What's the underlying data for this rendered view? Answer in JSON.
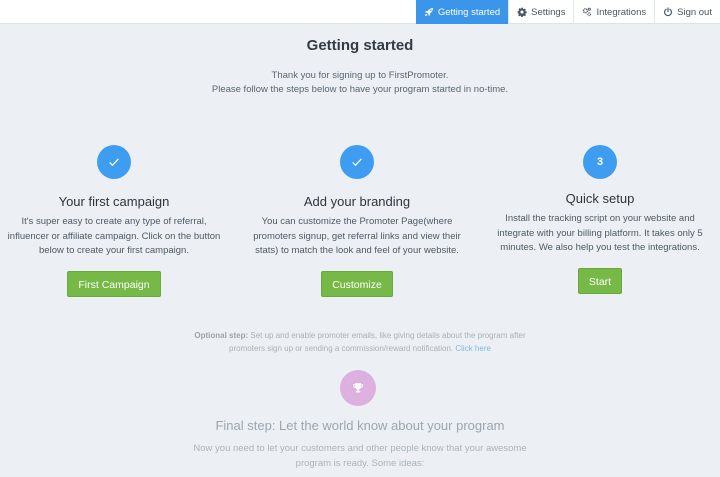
{
  "nav": {
    "items": [
      {
        "label": "Getting started",
        "icon": "rocket-icon"
      },
      {
        "label": "Settings",
        "icon": "gear-icon"
      },
      {
        "label": "Integrations",
        "icon": "gears-icon"
      },
      {
        "label": "Sign out",
        "icon": "power-icon"
      }
    ],
    "active_color": "#3b95e8"
  },
  "page": {
    "title": "Getting started",
    "intro_line1": "Thank you for signing up to FirstPromoter.",
    "intro_line2": "Please follow the steps below to have your program started in no-time."
  },
  "steps": [
    {
      "badge": "✓",
      "title": "Your first campaign",
      "desc": [
        "It's super easy to create any type of referral,",
        "influencer or affiliate campaign. Click on the button",
        "below to create your first campaign."
      ],
      "button": "First Campaign"
    },
    {
      "badge": "✓",
      "title": "Add your branding",
      "desc": [
        "You can customize the Promoter Page(where",
        "promoters signup, get referral links and view their",
        "stats) to match the look and feel of your website."
      ],
      "button": "Customize"
    },
    {
      "badge": "3",
      "title": "Quick setup",
      "desc": [
        "Install the tracking script on your website and",
        "integrate with your billing platform. It takes only 5",
        "minutes. We also help you test the integrations."
      ],
      "button": "Start"
    }
  ],
  "optional": {
    "label": "Optional step:",
    "line1_rest": " Set up and enable promoter emails, like giving details about the program after",
    "line2": "promoters sign up or sending a commission/reward notification. ",
    "link": "Click here"
  },
  "final": {
    "icon": "trophy-icon",
    "title": "Final step: Let the world know about your program",
    "desc_line1": "Now you need to let your customers and other people know that your awesome",
    "desc_line2": "program is ready. Some ideas:"
  },
  "colors": {
    "step_circle": "#3e9df0",
    "button": "#76b947",
    "trophy_circle": "#dcb0df",
    "link": "#7fb7e6"
  }
}
